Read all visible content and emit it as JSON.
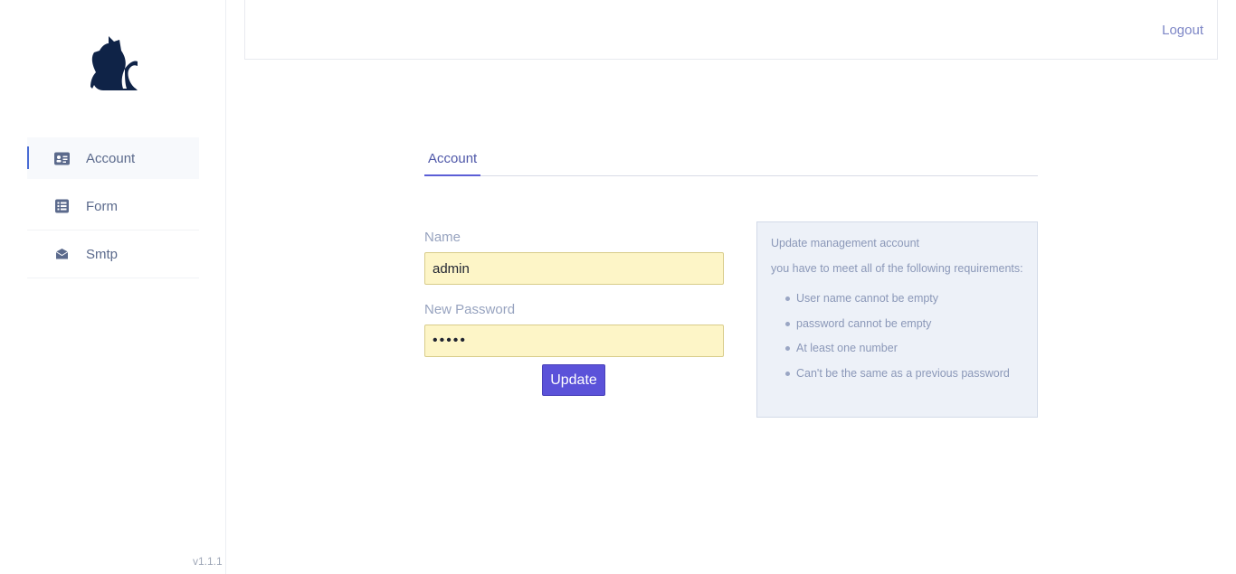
{
  "app": {
    "version": "v1.1.1",
    "logo_name": "cat-logo"
  },
  "sidebar": {
    "items": [
      {
        "label": "Account",
        "icon": "id-card-icon",
        "active": true
      },
      {
        "label": "Form",
        "icon": "list-icon",
        "active": false
      },
      {
        "label": "Smtp",
        "icon": "envelope-icon",
        "active": false
      }
    ]
  },
  "header": {
    "logout_label": "Logout"
  },
  "tabs": [
    {
      "label": "Account",
      "active": true
    }
  ],
  "form": {
    "name_label": "Name",
    "name_value": "admin",
    "password_label": "New Password",
    "password_value": "•••••",
    "submit_label": "Update"
  },
  "info": {
    "title": "Update management account",
    "intro": "you have to meet all of the following requirements:",
    "requirements": [
      "User name cannot be empty",
      "password cannot be empty",
      "At least one number",
      "Can't be the same as a previous password"
    ]
  },
  "colors": {
    "accent": "#5b52d9",
    "sidebar_active_bar": "#4a6cd4",
    "input_bg": "#fdf5c7",
    "info_bg": "#edf1f8",
    "logo": "#0f2347"
  }
}
